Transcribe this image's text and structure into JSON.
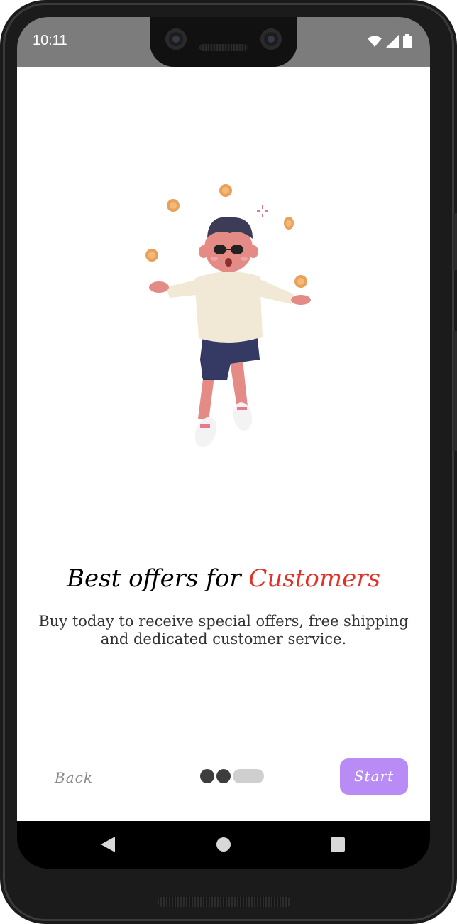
{
  "status_bar": {
    "time": "10:11",
    "icons": [
      "wifi-icon",
      "signal-icon",
      "battery-icon"
    ]
  },
  "onboarding": {
    "title_prefix": "Best offers for ",
    "title_accent": "Customers",
    "subtitle": "Buy today to receive special offers, free shipping and dedicated customer service.",
    "back_label": "Back",
    "start_label": "Start",
    "page_indicator": {
      "total": 3,
      "current": 3
    },
    "illustration": "man-juggling-coins-illustration"
  },
  "nav_bar": {
    "icons": [
      "back-triangle-icon",
      "home-circle-icon",
      "recents-square-icon"
    ]
  },
  "colors": {
    "accent": "#e2332b",
    "start_button": "#b88cf4",
    "status_bar": "#7c7c7c"
  }
}
